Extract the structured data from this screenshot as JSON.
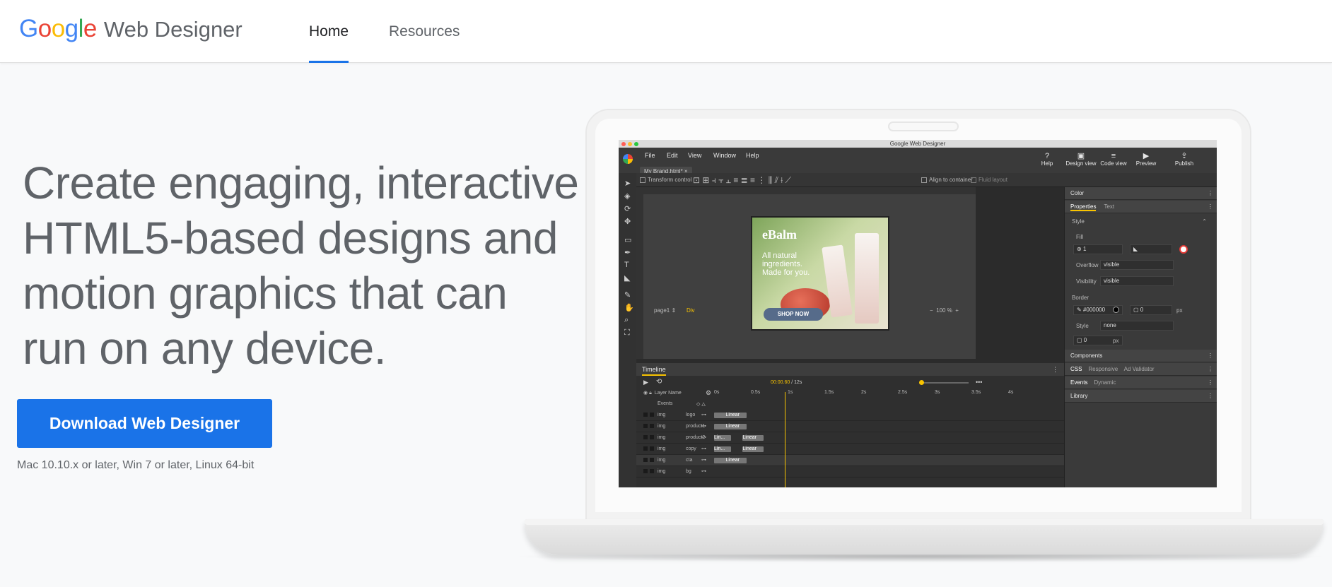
{
  "header": {
    "logo": {
      "google": [
        "G",
        "o",
        "o",
        "g",
        "l",
        "e"
      ],
      "product": "Web Designer"
    },
    "tabs": [
      {
        "label": "Home",
        "active": true
      },
      {
        "label": "Resources",
        "active": false
      }
    ]
  },
  "hero": {
    "headline_lines": [
      "Create engaging, interactive",
      "HTML5-based designs and",
      "motion graphics that can",
      "run on any device."
    ],
    "download_label": "Download Web Designer",
    "requirements": "Mac 10.10.x or later, Win 7 or later, Linux 64-bit"
  },
  "app": {
    "window_title": "Google Web Designer",
    "menu": [
      "File",
      "Edit",
      "View",
      "Window",
      "Help"
    ],
    "document_tab": "My Brand.html* ×",
    "actions": [
      {
        "icon": "help-icon",
        "label": "Help"
      },
      {
        "icon": "design-view-icon",
        "label": "Design view"
      },
      {
        "icon": "code-view-icon",
        "label": "Code view"
      },
      {
        "icon": "preview-icon",
        "label": "Preview"
      },
      {
        "icon": "publish-icon",
        "label": "Publish"
      }
    ],
    "options": {
      "transform_control": "Transform control",
      "align_to_container": "Align to container",
      "fluid_layout": "Fluid layout"
    },
    "ad": {
      "brand": "eBalm",
      "copy": "All natural ingredients. Made for you.",
      "cta": "SHOP NOW"
    },
    "canvas_footer": {
      "page": "page1 ⇕",
      "element": "Div",
      "zoom": "100 %"
    },
    "timeline": {
      "title": "Timeline",
      "time": "00:00.60",
      "duration": "/ 12s",
      "layer_name_header": "Layer Name",
      "events_label": "Events",
      "ticks": [
        "0s",
        "0.5s",
        "1s",
        "1.5s",
        "2s",
        "2.5s",
        "3s",
        "3.5s",
        "4s"
      ],
      "layers": [
        {
          "type": "img",
          "name": "logo",
          "bars": [
            {
              "label": "Linear"
            }
          ]
        },
        {
          "type": "img",
          "name": "product1",
          "bars": [
            {
              "label": "Linear"
            }
          ]
        },
        {
          "type": "img",
          "name": "product2",
          "bars": [
            {
              "label": "Lin..."
            },
            {
              "label": "Linear"
            }
          ]
        },
        {
          "type": "img",
          "name": "copy",
          "bars": [
            {
              "label": "Lin..."
            },
            {
              "label": "Linear"
            }
          ]
        },
        {
          "type": "img",
          "name": "cta",
          "bars": [
            {
              "label": "Linear"
            }
          ]
        },
        {
          "type": "img",
          "name": "bg",
          "bars": []
        }
      ]
    },
    "panel": {
      "color": "Color",
      "tabs": [
        "Properties",
        "Text"
      ],
      "style": "Style",
      "fill": "Fill",
      "fill_value": "1",
      "overflow_label": "Overflow",
      "overflow_value": "visible",
      "visibility_label": "Visibility",
      "visibility_value": "visible",
      "border": "Border",
      "border_color": "#000000",
      "border_width": "0",
      "border_unit": "px",
      "border_style_label": "Style",
      "border_style_value": "none",
      "radius_value": "0",
      "radius_unit": "px",
      "components": "Components",
      "css_tabs": [
        "CSS",
        "Responsive",
        "Ad Validator"
      ],
      "events_tabs": [
        "Events",
        "Dynamic"
      ],
      "library": "Library"
    }
  }
}
